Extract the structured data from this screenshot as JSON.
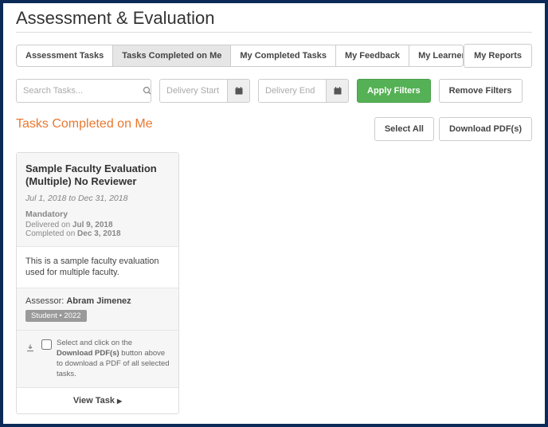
{
  "header": {
    "title": "Assessment & Evaluation"
  },
  "tabs": [
    {
      "label": "Assessment Tasks",
      "active": false
    },
    {
      "label": "Tasks Completed on Me",
      "active": true
    },
    {
      "label": "My Completed Tasks",
      "active": false
    },
    {
      "label": "My Feedback",
      "active": false
    },
    {
      "label": "My Learners",
      "active": false
    }
  ],
  "top_right_button": "My Reports",
  "filters": {
    "search_placeholder": "Search Tasks...",
    "start_placeholder": "Delivery Start",
    "end_placeholder": "Delivery End",
    "apply_label": "Apply Filters",
    "remove_label": "Remove Filters"
  },
  "section": {
    "title": "Tasks Completed on Me",
    "select_all": "Select All",
    "download_pdfs": "Download PDF(s)"
  },
  "card": {
    "title": "Sample Faculty Evaluation (Multiple) No Reviewer",
    "date_range": "Jul 1, 2018 to Dec 31, 2018",
    "mandatory": "Mandatory",
    "delivered_prefix": "Delivered on ",
    "delivered_date": "Jul 9, 2018",
    "completed_prefix": "Completed on ",
    "completed_date": "Dec 3, 2018",
    "description": "This is a sample faculty evaluation used for multiple faculty.",
    "assessor_label": "Assessor: ",
    "assessor_name": "Abram Jimenez",
    "badge": "Student • 2022",
    "hint_pre": "Select and click on the ",
    "hint_bold": "Download PDF(s)",
    "hint_post": " button above to download a PDF of all selected tasks.",
    "view_task": "View Task"
  }
}
